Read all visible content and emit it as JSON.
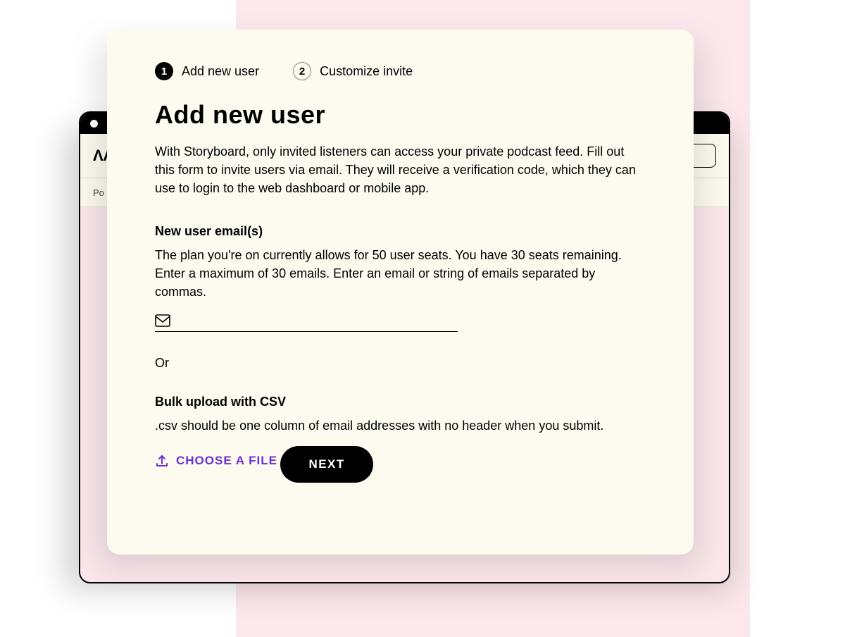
{
  "background": {
    "subbar_text": "Po"
  },
  "stepper": {
    "steps": [
      {
        "number": "1",
        "label": "Add new user",
        "active": true
      },
      {
        "number": "2",
        "label": "Customize invite",
        "active": false
      }
    ]
  },
  "modal": {
    "title": "Add new user",
    "description": "With Storyboard, only invited listeners can access your private podcast feed. Fill out this form to invite users via email. They will receive a verification code, which they can use to login to the web dashboard or mobile app."
  },
  "email_section": {
    "label": "New user email(s)",
    "help": "The plan you're on currently allows for 50 user seats. You have 30 seats remaining. Enter a maximum of 30 emails. Enter an email or string of emails separated by commas.",
    "placeholder": ""
  },
  "divider": {
    "or": "Or"
  },
  "csv_section": {
    "label": "Bulk upload with CSV",
    "help": ".csv should be one column of email addresses with no header when you submit.",
    "choose_file_label": "CHOOSE A FILE"
  },
  "actions": {
    "next": "NEXT"
  },
  "colors": {
    "accent": "#6a2fd9",
    "modal_bg": "#fdfaf0",
    "pink": "#fce8ec"
  }
}
